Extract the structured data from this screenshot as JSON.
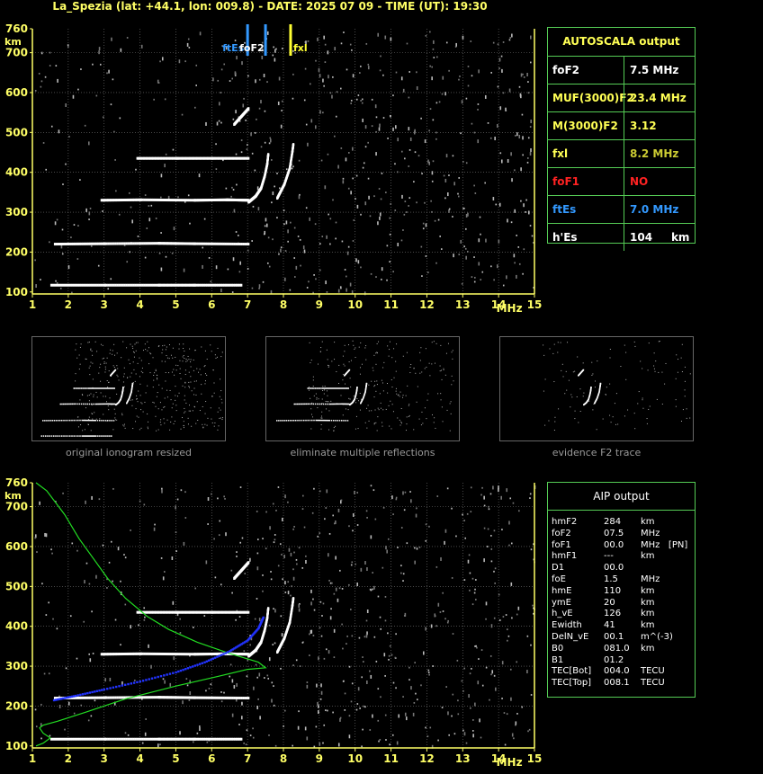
{
  "header": {
    "title": "La_Spezia (lat: +44.1, lon: 009.8) - DATE: 2025 07 09 - TIME (UT): 19:30"
  },
  "colors": {
    "axis": "#ffff66",
    "panel_border": "#55cc55",
    "trace": "#ffffff",
    "grid": "#777777",
    "foF2_marker": "#3399ff",
    "fxl_marker": "#ffff33",
    "aip_profile": "#22dd22",
    "aip_points": "#2233ff",
    "no_value": "#ff2222"
  },
  "chart_data": [
    {
      "type": "scatter",
      "name": "ionogram",
      "xlabel": "MHz",
      "ylabel": "km",
      "xlim": [
        1,
        15
      ],
      "ylim": [
        95,
        760
      ],
      "xticks": [
        "1",
        "2",
        "3",
        "4",
        "5",
        "6",
        "7",
        "8",
        "9",
        "10",
        "11",
        "12",
        "13",
        "14",
        "15"
      ],
      "yticks": [
        "100",
        "200",
        "300",
        "400",
        "500",
        "600",
        "700",
        "760"
      ],
      "grid": true,
      "markers": [
        {
          "label": "ftEs",
          "x": 7.0,
          "color": "#3399ff"
        },
        {
          "label": "foF2",
          "x": 7.5,
          "color": "#3399ff"
        },
        {
          "label": "fxl",
          "x": 8.2,
          "color": "#ffff33"
        }
      ],
      "traces": [
        {
          "name": "Es",
          "points": [
            [
              1.5,
              117
            ],
            [
              3.0,
              117
            ],
            [
              4.5,
              117
            ],
            [
              5.5,
              117
            ],
            [
              6.8,
              117
            ]
          ]
        },
        {
          "name": "Es 2nd",
          "points": [
            [
              1.6,
              220
            ],
            [
              3.0,
              221
            ],
            [
              4.5,
              222
            ],
            [
              5.5,
              221
            ],
            [
              7.0,
              220
            ]
          ]
        },
        {
          "name": "Es 3rd",
          "points": [
            [
              2.9,
              330
            ],
            [
              4.0,
              331
            ],
            [
              5.5,
              330
            ],
            [
              6.4,
              331
            ],
            [
              7.0,
              330
            ]
          ]
        },
        {
          "name": "Es 4th",
          "points": [
            [
              3.9,
              435
            ],
            [
              5.0,
              435
            ],
            [
              6.0,
              435
            ],
            [
              7.0,
              435
            ]
          ]
        },
        {
          "name": "F2 O",
          "points": [
            [
              7.0,
              325
            ],
            [
              7.2,
              340
            ],
            [
              7.35,
              360
            ],
            [
              7.45,
              390
            ],
            [
              7.52,
              420
            ],
            [
              7.55,
              445
            ]
          ]
        },
        {
          "name": "F2 X",
          "points": [
            [
              7.8,
              335
            ],
            [
              8.0,
              370
            ],
            [
              8.15,
              410
            ],
            [
              8.22,
              450
            ],
            [
              8.25,
              470
            ]
          ]
        },
        {
          "name": "F2 2nd",
          "points": [
            [
              6.6,
              520
            ],
            [
              6.8,
              540
            ],
            [
              7.0,
              560
            ]
          ]
        }
      ],
      "noise_seed": 11
    },
    {
      "type": "line",
      "name": "aip_profile",
      "xlabel": "MHz",
      "ylabel": "km",
      "xlim": [
        1,
        15
      ],
      "ylim": [
        95,
        760
      ],
      "xticks": [
        "1",
        "2",
        "3",
        "4",
        "5",
        "6",
        "7",
        "8",
        "9",
        "10",
        "11",
        "12",
        "13",
        "14",
        "15"
      ],
      "yticks": [
        "100",
        "200",
        "300",
        "400",
        "500",
        "600",
        "700",
        "760"
      ],
      "series": [
        {
          "name": "profile",
          "color": "#22dd22",
          "points": [
            [
              1.1,
              100
            ],
            [
              1.3,
              107
            ],
            [
              1.5,
              120
            ],
            [
              1.3,
              132
            ],
            [
              1.2,
              145
            ],
            [
              1.3,
              152
            ],
            [
              1.7,
              162
            ],
            [
              2.5,
              185
            ],
            [
              3.6,
              218
            ],
            [
              5.0,
              250
            ],
            [
              6.2,
              275
            ],
            [
              7.0,
              292
            ],
            [
              7.5,
              296
            ],
            [
              7.3,
              310
            ],
            [
              6.5,
              332
            ],
            [
              5.6,
              360
            ],
            [
              4.8,
              392
            ],
            [
              4.2,
              425
            ],
            [
              3.6,
              470
            ],
            [
              3.1,
              520
            ],
            [
              2.7,
              570
            ],
            [
              2.3,
              620
            ],
            [
              1.9,
              680
            ],
            [
              1.4,
              740
            ],
            [
              1.1,
              760
            ]
          ]
        },
        {
          "name": "points",
          "color": "#2233ff",
          "points": [
            [
              1.6,
              215
            ],
            [
              2.2,
              226
            ],
            [
              3.0,
              242
            ],
            [
              4.0,
              262
            ],
            [
              5.0,
              285
            ],
            [
              5.8,
              310
            ],
            [
              6.5,
              338
            ],
            [
              7.0,
              365
            ],
            [
              7.3,
              395
            ],
            [
              7.45,
              425
            ]
          ]
        }
      ],
      "noise_seed": 29
    }
  ],
  "autoscala": {
    "title": "AUTOSCALA output",
    "rows": [
      {
        "label": "foF2",
        "value": "7.5 MHz",
        "label_color": "#ffffff",
        "value_color": "#ffffff"
      },
      {
        "label": "MUF(3000)F2",
        "value": "23.4 MHz",
        "label_color": "#ffff55",
        "value_color": "#ffff55"
      },
      {
        "label": "M(3000)F2",
        "value": "3.12",
        "label_color": "#ffff55",
        "value_color": "#ffff55"
      },
      {
        "label": "fxl",
        "value": "8.2 MHz",
        "label_color": "#ffff55",
        "value_color": "#cccc33"
      },
      {
        "label": "foF1",
        "value": "NO",
        "label_color": "#ff2222",
        "value_color": "#ff2222"
      },
      {
        "label": "ftEs",
        "value": "7.0 MHz",
        "label_color": "#3399ff",
        "value_color": "#3399ff"
      },
      {
        "label": "h'Es",
        "value": "104     km",
        "label_color": "#ffffff",
        "value_color": "#ffffff"
      }
    ]
  },
  "thumbnails": [
    {
      "caption": "original ionogram resized"
    },
    {
      "caption": "eliminate multiple reflections"
    },
    {
      "caption": "evidence F2 trace"
    }
  ],
  "aip": {
    "title": "AIP output",
    "rows": [
      {
        "k": "hmF2",
        "v": "284",
        "u": "km"
      },
      {
        "k": "foF2",
        "v": "07.5",
        "u": "MHz"
      },
      {
        "k": "foF1",
        "v": "00.0",
        "u": "MHz   [PN]"
      },
      {
        "k": "hmF1",
        "v": "---",
        "u": "km"
      },
      {
        "k": "D1",
        "v": "00.0",
        "u": ""
      },
      {
        "k": "foE",
        "v": "1.5",
        "u": "MHz"
      },
      {
        "k": "hmE",
        "v": "110",
        "u": "km"
      },
      {
        "k": "ymE",
        "v": "20",
        "u": "km"
      },
      {
        "k": "h_vE",
        "v": "126",
        "u": "km"
      },
      {
        "k": "Ewidth",
        "v": "41",
        "u": "km"
      },
      {
        "k": "DelN_vE",
        "v": "00.1",
        "u": "m^(-3)"
      },
      {
        "k": "B0",
        "v": "081.0",
        "u": "km"
      },
      {
        "k": "B1",
        "v": "01.2",
        "u": ""
      },
      {
        "k": "TEC[Bot]",
        "v": "004.0",
        "u": "TECU"
      },
      {
        "k": "TEC[Top]",
        "v": "008.1",
        "u": "TECU"
      }
    ]
  }
}
